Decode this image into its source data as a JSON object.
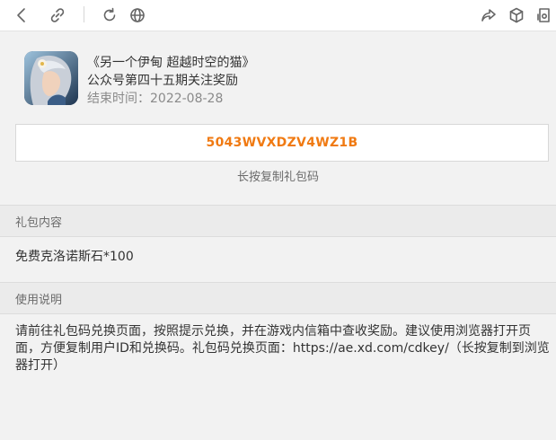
{
  "toolbar": {
    "icons": [
      "back-icon",
      "link-icon",
      "refresh-icon",
      "globe-icon",
      "share-icon",
      "cube-icon",
      "device-icon"
    ]
  },
  "game": {
    "title": "《另一个伊甸 超越时空的猫》",
    "subtitle": "公众号第四十五期关注奖励",
    "end_time": "结束时间：2022-08-28"
  },
  "code": {
    "value": "5043WVXDZV4WZ1B",
    "copy_hint": "长按复制礼包码",
    "color": "#f07a12"
  },
  "sections": {
    "content_title": "礼包内容",
    "content_text": "免费克洛诺斯石*100",
    "usage_title": "使用说明",
    "usage_text": "请前往礼包码兑换页面，按照提示兑换，并在游戏内信箱中查收奖励。建议使用浏览器打开页面，方便复制用户ID和兑换码。礼包码兑换页面：https://ae.xd.com/cdkey/（长按复制到浏览器打开）"
  }
}
